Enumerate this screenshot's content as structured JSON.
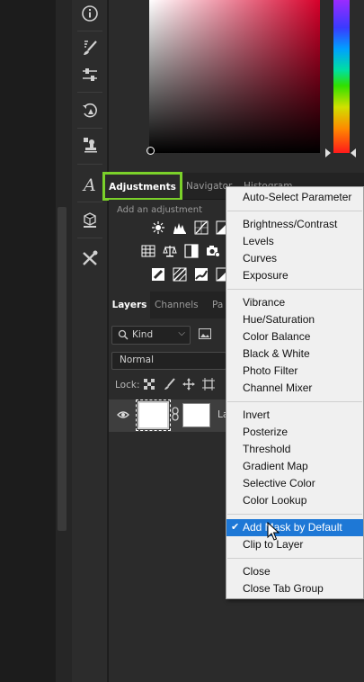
{
  "adjustments_panel": {
    "tabs": [
      {
        "label": "Adjustments"
      },
      {
        "label": "Navigator"
      },
      {
        "label": "Histogram"
      }
    ],
    "hint": "Add an adjustment"
  },
  "layers_panel": {
    "tabs": [
      {
        "label": "Layers"
      },
      {
        "label": "Channels"
      },
      {
        "label": "Pa"
      }
    ],
    "filter_kind": "Kind",
    "blend_mode": "Normal",
    "lock_label": "Lock:",
    "layer_name": "La"
  },
  "menu": {
    "items": [
      {
        "label": "Auto-Select Parameter"
      },
      {
        "label": "Brightness/Contrast"
      },
      {
        "label": "Levels"
      },
      {
        "label": "Curves"
      },
      {
        "label": "Exposure"
      },
      {
        "label": "Vibrance"
      },
      {
        "label": "Hue/Saturation"
      },
      {
        "label": "Color Balance"
      },
      {
        "label": "Black & White"
      },
      {
        "label": "Photo Filter"
      },
      {
        "label": "Channel Mixer"
      },
      {
        "label": "Invert"
      },
      {
        "label": "Posterize"
      },
      {
        "label": "Threshold"
      },
      {
        "label": "Gradient Map"
      },
      {
        "label": "Selective Color"
      },
      {
        "label": "Color Lookup"
      },
      {
        "label": "Add Mask by Default",
        "checked": true,
        "highlighted": true
      },
      {
        "label": "Clip to Layer"
      },
      {
        "label": "Close"
      },
      {
        "label": "Close Tab Group"
      }
    ],
    "check_glyph": "✔"
  },
  "colors": {
    "highlight": "#1e78d6",
    "accent_outline": "#7bd12a"
  },
  "icons": {
    "tools": [
      "info-icon",
      "brush-settings-icon",
      "adjust-sliders-icon",
      "history-icon",
      "stamp-icon",
      "glyphs-icon",
      "3d-icon",
      "tools-icon"
    ],
    "adjustments": [
      "brightness-icon",
      "levels-icon",
      "curves-icon",
      "exposure-icon",
      "vibrance-icon",
      "hue-saturation-icon",
      "color-balance-icon",
      "black-white-icon",
      "photo-filter-icon",
      "channel-mixer-icon",
      "color-lookup-icon",
      "invert-icon",
      "posterize-icon",
      "threshold-icon",
      "gradient-map-icon"
    ]
  }
}
